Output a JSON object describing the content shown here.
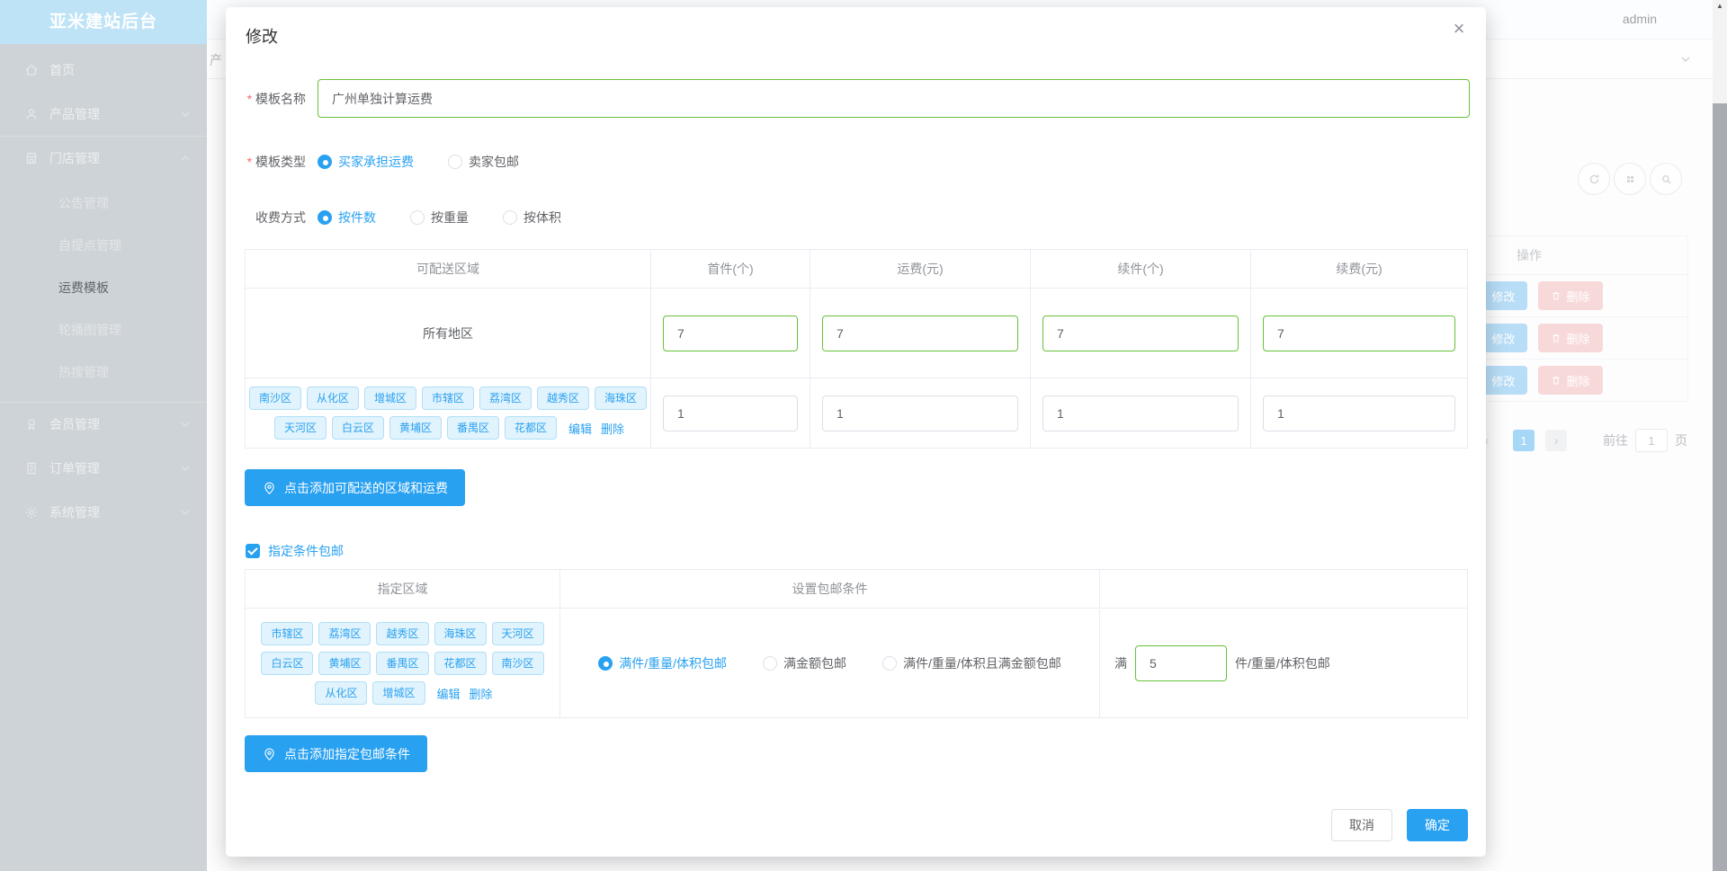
{
  "app": {
    "brand": "亚米建站后台",
    "admin": "admin",
    "breadcrumb_partial": "产"
  },
  "sidebar": {
    "items": [
      {
        "label": "首页"
      },
      {
        "label": "产品管理"
      },
      {
        "label": "门店管理"
      },
      {
        "label": "会员管理"
      },
      {
        "label": "订单管理"
      },
      {
        "label": "系统管理"
      }
    ],
    "store_children": [
      "公告管理",
      "自提点管理",
      "运费模板",
      "轮播图管理",
      "热搜管理"
    ]
  },
  "background": {
    "ops_header": "操作",
    "edit_label": "修改",
    "delete_label": "删除",
    "pagination": {
      "prev": "‹",
      "active_page": "1",
      "next": "›",
      "goto_label": "前往",
      "goto_value": "1",
      "unit_label": "页"
    }
  },
  "modal": {
    "title": "修改",
    "close": "×",
    "name_field": {
      "label": "模板名称",
      "value": "广州单独计算运费"
    },
    "type_field": {
      "label": "模板类型",
      "options": [
        "买家承担运费",
        "卖家包邮"
      ]
    },
    "method_field": {
      "label": "收费方式",
      "options": [
        "按件数",
        "按重量",
        "按体积"
      ]
    },
    "shipping_table": {
      "headers": [
        "可配送区域",
        "首件(个)",
        "运费(元)",
        "续件(个)",
        "续费(元)"
      ],
      "row_all": {
        "region": "所有地区",
        "values": [
          "7",
          "7",
          "7",
          "7"
        ]
      },
      "row_custom": {
        "tags": [
          "南沙区",
          "从化区",
          "增城区",
          "市辖区",
          "荔湾区",
          "越秀区",
          "海珠区",
          "天河区",
          "白云区",
          "黄埔区",
          "番禺区",
          "花都区"
        ],
        "edit": "编辑",
        "remove": "删除",
        "values": [
          "1",
          "1",
          "1",
          "1"
        ]
      }
    },
    "add_region_button": "点击添加可配送的区域和运费",
    "free_condition_checkbox": "指定条件包邮",
    "condition_table": {
      "headers": [
        "指定区域",
        "设置包邮条件"
      ],
      "tags": [
        "市辖区",
        "荔湾区",
        "越秀区",
        "海珠区",
        "天河区",
        "白云区",
        "黄埔区",
        "番禺区",
        "花都区",
        "南沙区",
        "从化区",
        "增城区"
      ],
      "edit": "编辑",
      "remove": "删除",
      "options": [
        "满件/重量/体积包邮",
        "满金额包邮",
        "满件/重量/体积且满金额包邮"
      ],
      "threshold": {
        "prefix": "满",
        "value": "5",
        "suffix": "件/重量/体积包邮"
      }
    },
    "add_condition_button": "点击添加指定包邮条件",
    "footer": {
      "cancel": "取消",
      "confirm": "确定"
    }
  },
  "colors": {
    "primary": "#29a1f1",
    "success_border": "#67c23a",
    "danger": "#f56c6c"
  }
}
